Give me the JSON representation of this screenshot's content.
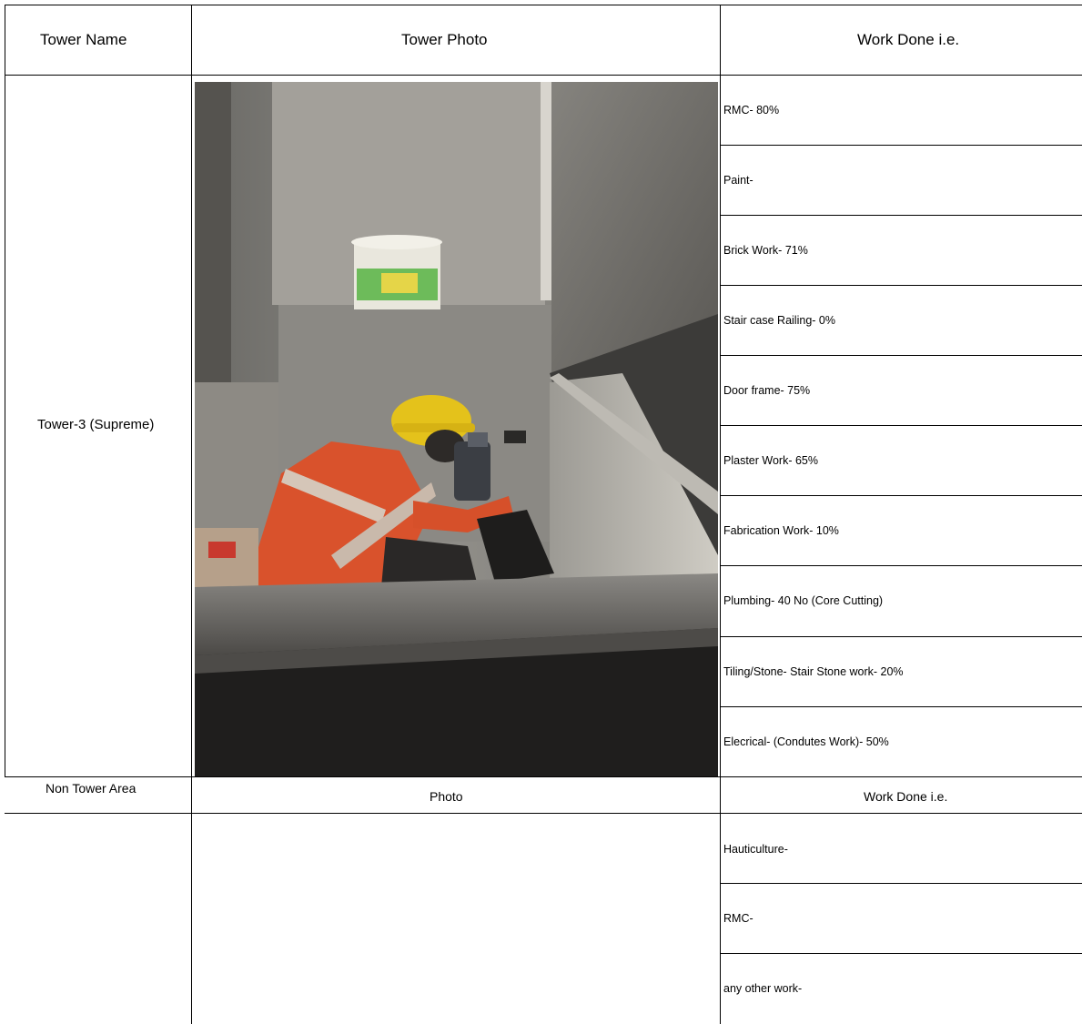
{
  "tower_table": {
    "headers": {
      "tower_name": "Tower Name",
      "tower_photo": "Tower Photo",
      "work_done": "Work Done i.e."
    },
    "tower_name": "Tower-3 (Supreme)",
    "work_items": [
      "RMC- 80%",
      "Paint-",
      "Brick Work- 71%",
      "Stair case Railing- 0%",
      "Door frame- 75%",
      "Plaster Work-  65%",
      "Fabrication Work- 10%",
      "Plumbing- 40 No (Core Cutting)",
      "Tiling/Stone- Stair Stone work- 20%",
      "Elecrical- (Condutes Work)- 50%"
    ]
  },
  "non_tower_table": {
    "headers": {
      "area": "Non Tower Area",
      "photo": "Photo",
      "work_done": "Work Done i.e."
    },
    "work_items": [
      "Hauticulture-",
      "RMC-",
      "any other work-"
    ]
  },
  "photo": {
    "icon": "site-photo-worker-core-cutting"
  }
}
